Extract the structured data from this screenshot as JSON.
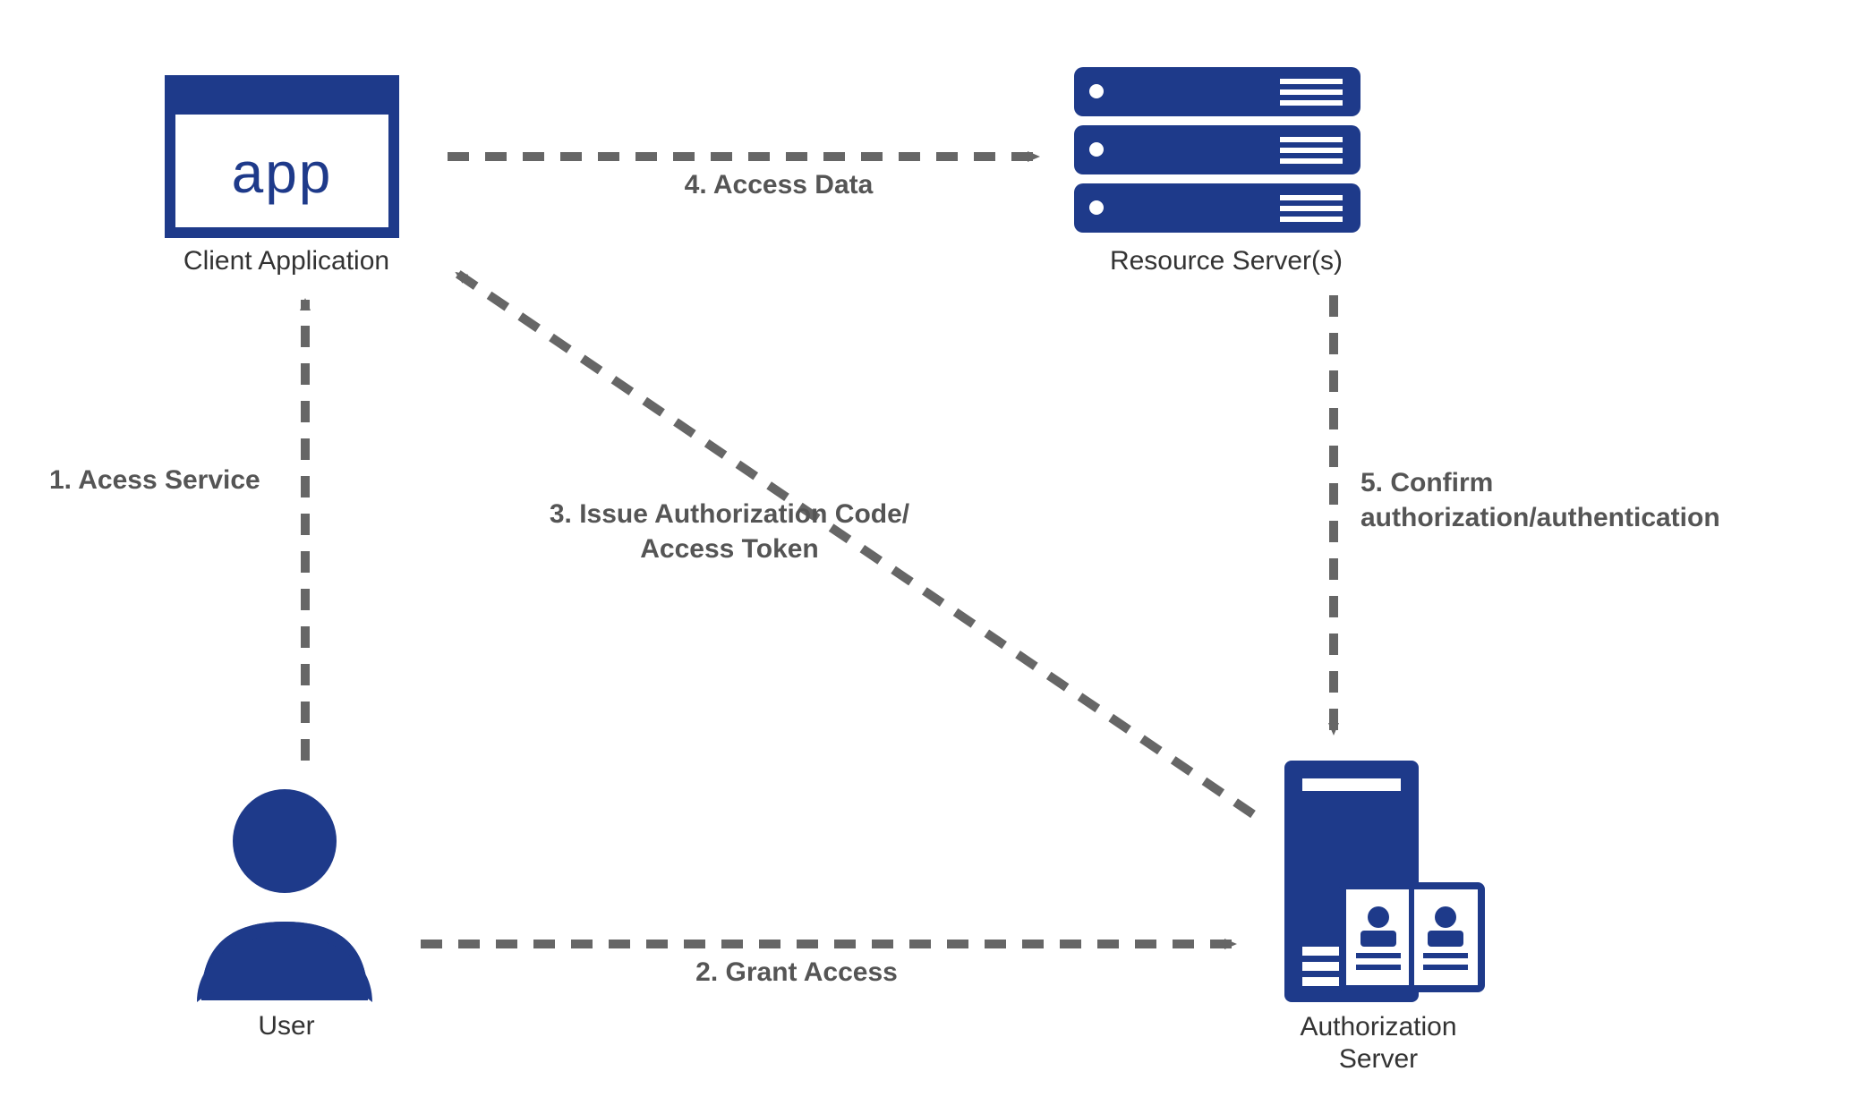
{
  "nodes": {
    "client_app": {
      "label": "Client Application",
      "icon_text": "app"
    },
    "resource_server": {
      "label": "Resource Server(s)"
    },
    "user": {
      "label": "User"
    },
    "auth_server": {
      "label_line1": "Authorization",
      "label_line2": "Server"
    }
  },
  "edges": {
    "step1": {
      "label": "1. Acess Service"
    },
    "step2": {
      "label": "2. Grant Access"
    },
    "step3": {
      "line1": "3. Issue Authorization Code/",
      "line2": "Access Token"
    },
    "step4": {
      "label": "4. Access Data"
    },
    "step5": {
      "line1": "5. Confirm",
      "line2": "authorization/authentication"
    }
  },
  "colors": {
    "primary": "#1e3a8a",
    "arrow": "#666666",
    "text": "#333333"
  }
}
